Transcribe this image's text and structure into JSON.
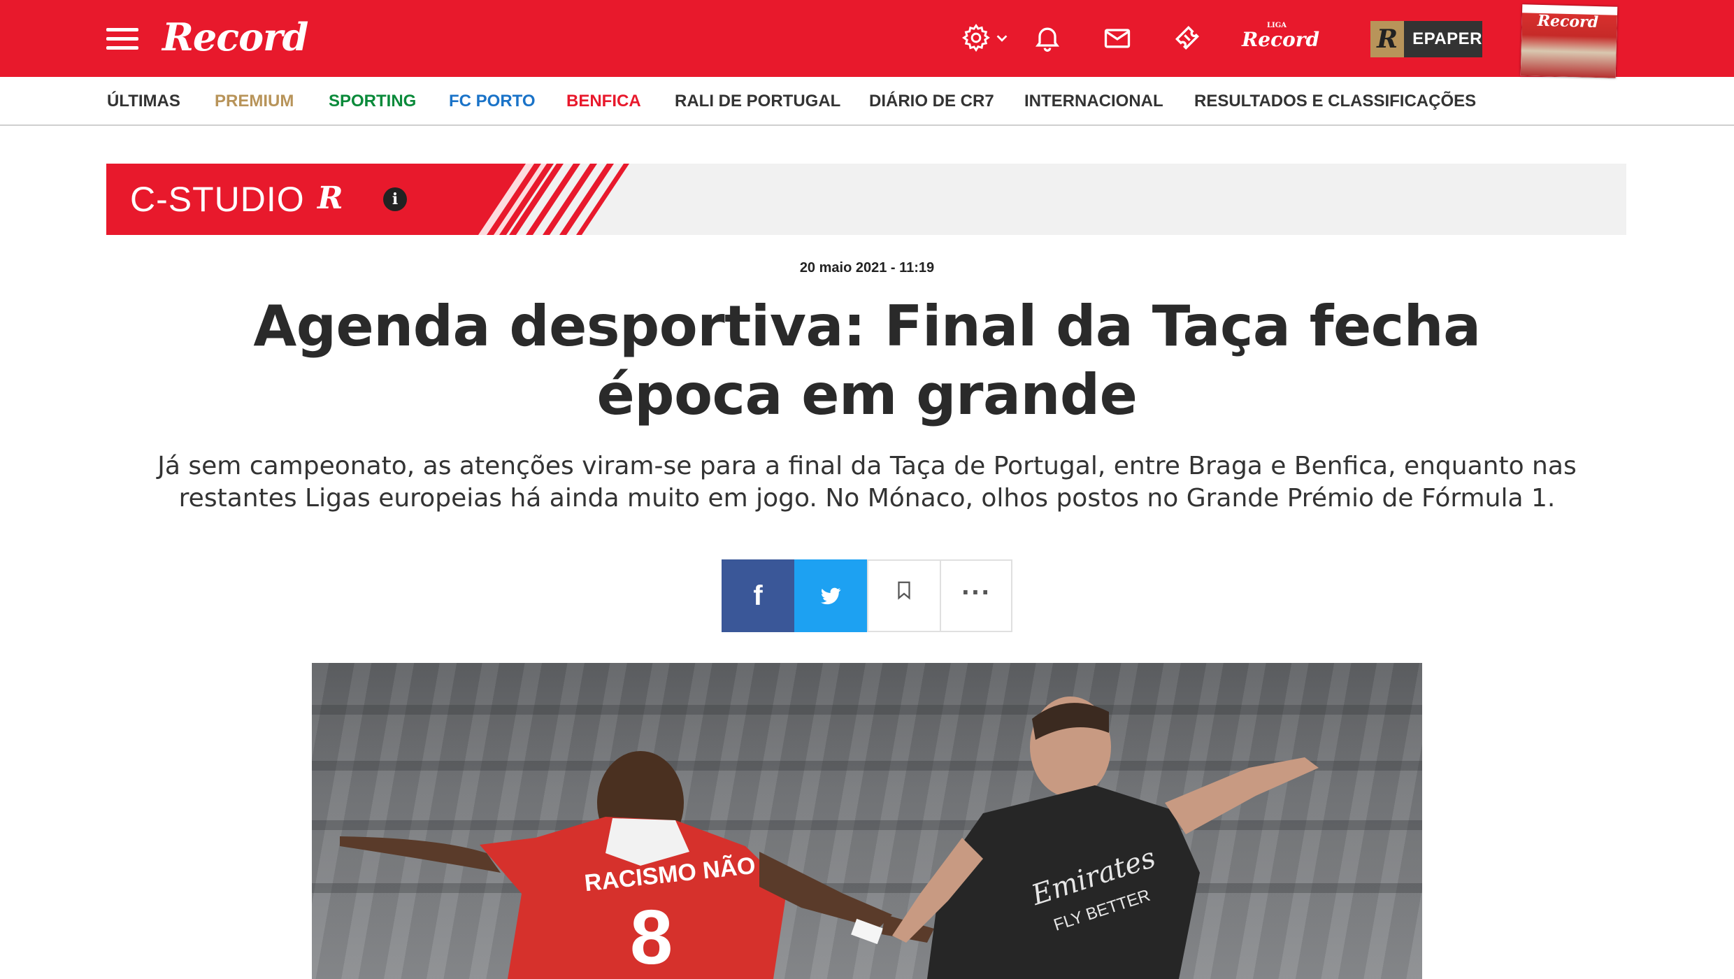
{
  "header": {
    "logo_text": "Record",
    "liga_logo_text": "Record",
    "liga_logo_small": "LIGA",
    "epaper_label": "EPAPER",
    "epaper_letter": "R",
    "cover_title": "Record",
    "icons": [
      "menu-icon",
      "settings-icon",
      "chevron-down-icon",
      "bell-icon",
      "mail-icon",
      "ticket-icon"
    ],
    "brand_color": "#e8192c"
  },
  "nav": {
    "items": [
      {
        "label": "ÚLTIMAS",
        "color": "#333333"
      },
      {
        "label": "PREMIUM",
        "color": "#b8945a"
      },
      {
        "label": "SPORTING",
        "color": "#0a8a3a"
      },
      {
        "label": "FC PORTO",
        "color": "#1a73c8"
      },
      {
        "label": "BENFICA",
        "color": "#e8192c"
      },
      {
        "label": "RALI DE PORTUGAL",
        "color": "#333333"
      },
      {
        "label": "DIÁRIO DE CR7",
        "color": "#333333"
      },
      {
        "label": "INTERNACIONAL",
        "color": "#333333"
      },
      {
        "label": "RESULTADOS E CLASSIFICAÇÕES",
        "color": "#333333"
      }
    ]
  },
  "banner": {
    "label": "C-STUDIO",
    "logo_letter": "R",
    "info_glyph": "i"
  },
  "article": {
    "date": "20 maio 2021 - 11:19",
    "title": "Agenda desportiva: Final da Taça fecha época em grande",
    "lead": "Já sem campeonato, as atenções viram-se para a final da Taça de Portugal, entre Braga e Benfica, enquanto nas restantes Ligas europeias há ainda muito em jogo. No Mónaco, olhos postos no Grande Prémio de Fórmula 1."
  },
  "share": {
    "facebook_glyph": "f",
    "more_glyph": "···",
    "colors": {
      "facebook": "#3a5798",
      "twitter": "#1da1f2"
    }
  },
  "hero": {
    "shirt_text_left": "RACISMO NÃO",
    "shirt_number": "8",
    "shirt_text_right": "Emirates",
    "shirt_text_right_sub": "FLY BETTER"
  }
}
